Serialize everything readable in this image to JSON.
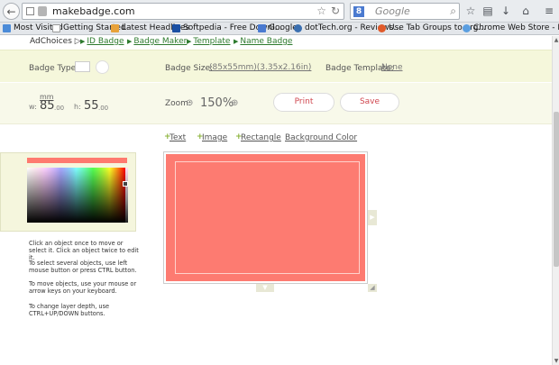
{
  "browser": {
    "url": "makebadge.com",
    "search_placeholder": "Google",
    "search_engine_letter": "8",
    "icons": {
      "back": "←",
      "bookmark_star": "☆",
      "reload": "↻",
      "search_go": "⌕",
      "star": "☆",
      "bookmarks_menu": "▤",
      "download": "↓",
      "home": "⌂",
      "menu": "≡"
    },
    "bookmarks": [
      {
        "label": "Most Visited",
        "color": "#4b8bd8"
      },
      {
        "label": "Getting Started",
        "color": "#6aa0e0"
      },
      {
        "label": "Latest Headlines",
        "color": "#e8a23a"
      },
      {
        "label": "Softpedia - Free Downl...",
        "color": "#1a4fa3"
      },
      {
        "label": "Google",
        "color": "#4a7ad0"
      },
      {
        "label": "dotTech.org - Reviews...",
        "color": "#3a6fb0"
      },
      {
        "label": "Use Tab Groups to org...",
        "color": "#e05a2a"
      },
      {
        "label": "Chrome Web Store - P...",
        "color": "#5a9ee0"
      }
    ]
  },
  "page": {
    "adchoices": "AdChoices ▷",
    "ad_links": [
      "ID Badge",
      "Badge Maker",
      "Template",
      "Name Badge"
    ],
    "options": {
      "badge_type_label": "Badge Type:",
      "badge_size_label": "Badge Size:",
      "badge_size_value": "(85x55mm)(3.35x2.16in)",
      "badge_template_label": "Badge Template:",
      "badge_template_value": "None"
    },
    "size": {
      "unit": "mm",
      "w_label": "w:",
      "w_value": "85",
      "w_decimal": ".00",
      "h_label": "h:",
      "h_value": "55",
      "h_decimal": ".00"
    },
    "zoom": {
      "label": "Zoom:",
      "out_icon": "⊖",
      "value": "150%",
      "in_icon": "⊕"
    },
    "print_label": "Print",
    "save_label": "Save",
    "add_plus": "+",
    "add_items": [
      "Text",
      "Image",
      "Rectangle",
      "Background Color"
    ],
    "selected_color": "#fe7a6f",
    "badge_color": "#fd7b71",
    "help": [
      "Click an object once to move or select it. Click an object twice to edit it.",
      "To select several objects, use left mouse button or press CTRL button.",
      "To move objects, use your mouse or arrow keys on your keyboard.",
      "To change layer depth, use CTRL+UP/DOWN buttons."
    ],
    "handles": {
      "right": "▶",
      "bottom": "▼",
      "corner": "◢"
    },
    "scroll": {
      "up": "▲",
      "down": "▼"
    }
  }
}
